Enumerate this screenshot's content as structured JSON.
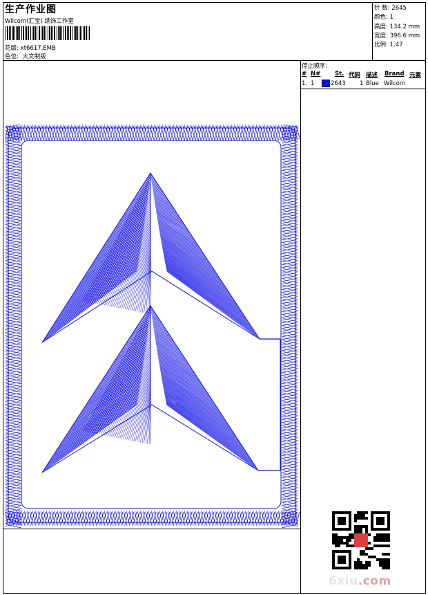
{
  "header": {
    "title": "生产作业图",
    "company": "Wilcom(汇宝) 绣饰工作室",
    "barcode_name": "barcode",
    "pattern_label": "花版:",
    "pattern_value": "xt6617.EMB",
    "colorway_label": "色位:",
    "colorway_value": "大文制版"
  },
  "stats": [
    {
      "label": "针 数:",
      "value": "2645"
    },
    {
      "label": "颜色:",
      "value": "1"
    },
    {
      "label": "高度:",
      "value": "134.2 mm"
    },
    {
      "label": "宽度:",
      "value": "396.6 mm"
    },
    {
      "label": "比例:",
      "value": "1.47"
    }
  ],
  "stop_sequence": {
    "title": "停止顺序:",
    "columns": [
      "#",
      "N#",
      "St.",
      "代码",
      "描述",
      "Brand",
      "元素"
    ],
    "rows": [
      {
        "idx": "1.",
        "n": "1",
        "swatch_color": "#0a14e6",
        "stitches": "2643",
        "code": "1",
        "description": "Blue",
        "brand": "Wilcom",
        "element": ""
      }
    ]
  },
  "design": {
    "stitch_color": "#1010e6",
    "motif": "double-chevron-up-in-satin-frame"
  },
  "watermark": {
    "text_main": "6xiu",
    "text_dot": ".com",
    "qr_icon": "qr-code-icon"
  }
}
